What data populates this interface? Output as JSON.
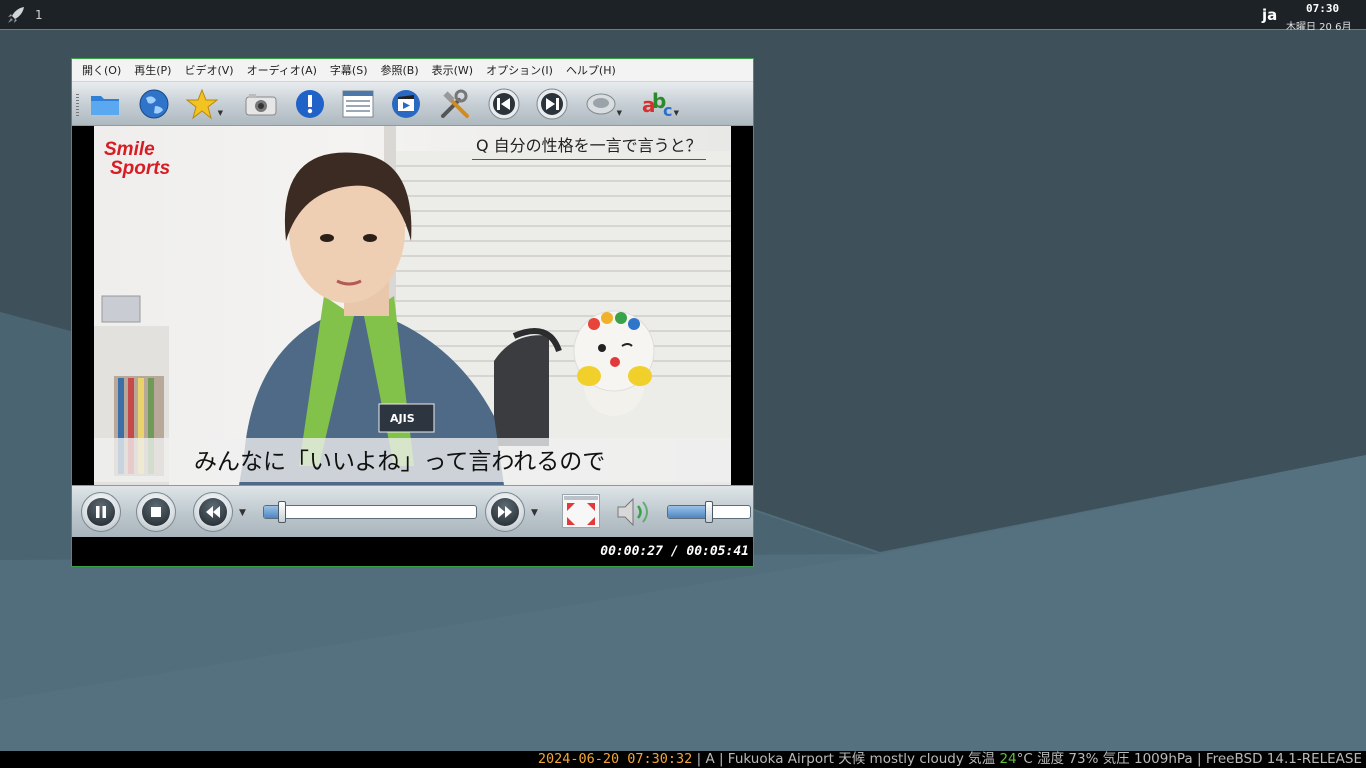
{
  "top_panel": {
    "workspace": "1",
    "ime": "ja",
    "clock_time": "07:30",
    "clock_date": "木曜日 20 6月"
  },
  "player": {
    "menu": [
      "開く(O)",
      "再生(P)",
      "ビデオ(V)",
      "オーディオ(A)",
      "字幕(S)",
      "参照(B)",
      "表示(W)",
      "オプション(I)",
      "ヘルプ(H)"
    ],
    "toolbar_icons": [
      "folder-icon",
      "globe-icon",
      "favorites-star-icon",
      "screenshot-camera-icon",
      "info-icon",
      "playlist-icon",
      "video-equalizer-icon",
      "preferences-tools-icon",
      "previous-icon",
      "next-icon",
      "audio-track-icon",
      "subtitle-track-icon"
    ],
    "video": {
      "logo_line1": "Smile",
      "logo_line2": "Sports",
      "question": "Q 自分の性格を一言で言うと？",
      "subtitle": "みんなに「いいよね」って言われるので"
    },
    "seek_progress": 0.08,
    "volume_level": 0.5,
    "time_display": "00:00:27 / 00:05:41",
    "colors": {
      "window_border": "#3aa048",
      "bar_fill": "#4f86c2"
    }
  },
  "bottom_bar": {
    "datetime": "2024-06-20 07:30:32",
    "sep1": " | A | Fukuoka Airport 天候 mostly cloudy 気温 ",
    "temp": "24",
    "rest": "°C 湿度 73% 気圧 1009hPa | FreeBSD 14.1-RELEASE"
  }
}
